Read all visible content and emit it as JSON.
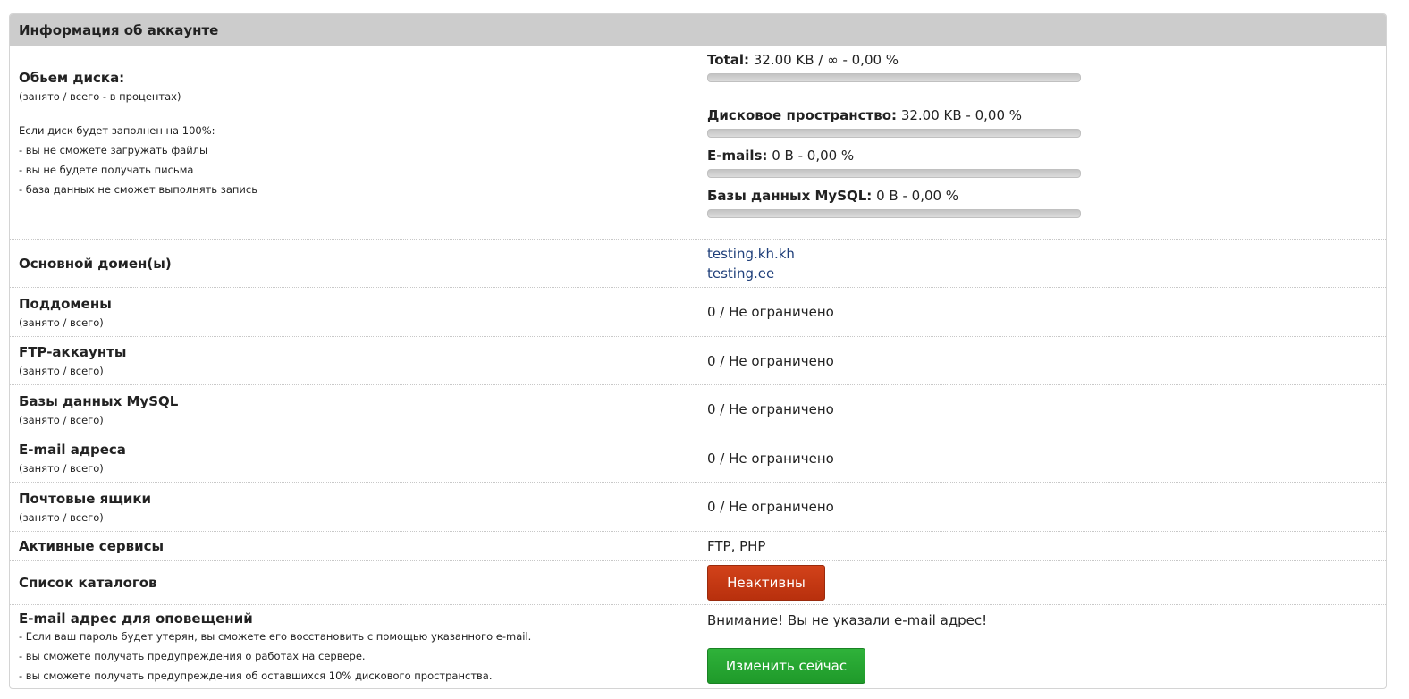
{
  "panel": {
    "title": "Информация об аккаунте"
  },
  "disk": {
    "label": "Обьем диска:",
    "hint": "(занято / всего - в процентах)",
    "notes": [
      "Если диск будет заполнен на 100%:",
      "- вы не сможете загружать файлы",
      "- вы не будете получать письма",
      "- база данных не сможет выполнять запись"
    ],
    "usage": [
      {
        "name": "Total:",
        "value": "32.00 KB / ∞ - 0,00 %",
        "percent": 0
      },
      {
        "name": "Дисковое пространство:",
        "value": "32.00 KB - 0,00 %",
        "percent": 0
      },
      {
        "name": "E-mails:",
        "value": "0 B - 0,00 %",
        "percent": 0
      },
      {
        "name": "Базы данных MySQL:",
        "value": "0 B - 0,00 %",
        "percent": 0
      }
    ]
  },
  "domains": {
    "label": "Основной домен(ы)",
    "items": [
      "testing.kh.kh",
      "testing.ee"
    ]
  },
  "limits": [
    {
      "label": "Поддомены",
      "hint": "(занято / всего)",
      "value": "0 / Не ограничено"
    },
    {
      "label": "FTP-аккаунты",
      "hint": "(занято / всего)",
      "value": "0 / Не ограничено"
    },
    {
      "label": "Базы данных MySQL",
      "hint": "(занято / всего)",
      "value": "0 / Не ограничено"
    },
    {
      "label": "E-mail адреса",
      "hint": "(занято / всего)",
      "value": "0 / Не ограничено"
    },
    {
      "label": "Почтовые ящики",
      "hint": "(занято / всего)",
      "value": "0 / Не ограничено"
    }
  ],
  "services": {
    "label": "Активные сервисы",
    "value": "FTP, PHP"
  },
  "catalogs": {
    "label": "Список каталогов",
    "button": "Неактивны",
    "button_color": "#c5391a"
  },
  "notify": {
    "label": "E-mail адрес для оповещений",
    "notes": [
      "- Если ваш пароль будет утерян, вы сможете его восстановить с помощью указанного e-mail.",
      "- вы сможете получать предупреждения о работах на сервере.",
      "- вы сможете получать предупреждения об оставшихся 10% дискового пространства."
    ],
    "warning": "Внимание! Вы не указали e-mail адрес!",
    "button": "Изменить сейчас",
    "button_color": "#28a734"
  }
}
